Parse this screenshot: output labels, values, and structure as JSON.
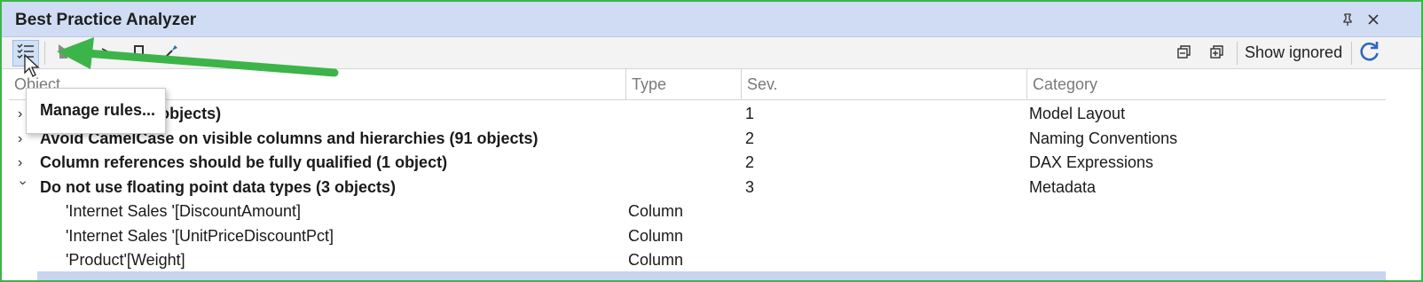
{
  "window": {
    "title": "Best Practice Analyzer",
    "pin_icon": "pin-icon",
    "close_icon": "close-icon"
  },
  "toolbar": {
    "tools": [
      "manage-rules-icon",
      "go-to-object-icon",
      "ignore-item-icon",
      "ignore-rule-icon",
      "apply-fix-icon"
    ],
    "collapse_all_icon": "collapse-all-icon",
    "expand_all_icon": "expand-all-icon",
    "show_ignored_label": "Show ignored",
    "refresh_icon": "refresh-icon"
  },
  "columns": {
    "object": "Object",
    "type": "Type",
    "severity": "Sev.",
    "category": "Category"
  },
  "rows": [
    {
      "kind": "group",
      "expanded": false,
      "name": "Hide objects not in perspectives (47 objects)",
      "visible_name": "erspectives (47 objects)",
      "type": "",
      "sev": "1",
      "category": "Model Layout"
    },
    {
      "kind": "group",
      "expanded": false,
      "name": "Avoid CamelCase on visible columns and hierarchies (91 objects)",
      "type": "",
      "sev": "2",
      "category": "Naming Conventions"
    },
    {
      "kind": "group",
      "expanded": false,
      "name": "Column references should be fully qualified (1 object)",
      "type": "",
      "sev": "2",
      "category": "DAX Expressions"
    },
    {
      "kind": "group",
      "expanded": true,
      "name": "Do not use floating point data types (3 objects)",
      "type": "",
      "sev": "3",
      "category": "Metadata"
    },
    {
      "kind": "item",
      "name": "'Internet Sales '[DiscountAmount]",
      "type": "Column",
      "sev": "",
      "category": ""
    },
    {
      "kind": "item",
      "name": "'Internet Sales '[UnitPriceDiscountPct]",
      "type": "Column",
      "sev": "",
      "category": ""
    },
    {
      "kind": "item",
      "name": "'Product'[Weight]",
      "type": "Column",
      "sev": "",
      "category": ""
    }
  ],
  "popup": {
    "manage_rules_label": "Manage rules..."
  },
  "annotation": {
    "arrow_color": "#3cb44a"
  }
}
